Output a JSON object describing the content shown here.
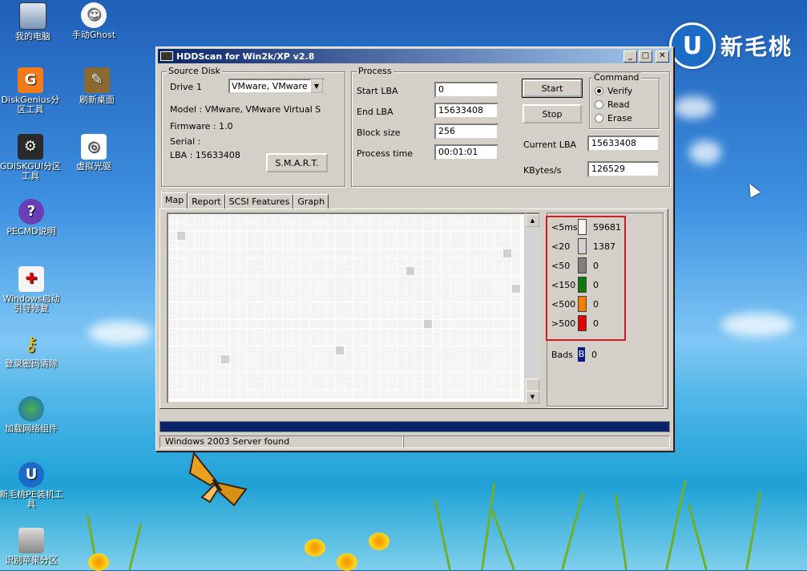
{
  "desktop": {
    "brand_text": "新毛桃",
    "icons": [
      {
        "label": "我的电脑"
      },
      {
        "label": "手动Ghost"
      },
      {
        "label": "DiskGenius分区工具"
      },
      {
        "label": "刷新桌面"
      },
      {
        "label": "GDISKGUI分区工具"
      },
      {
        "label": "虚拟光驱"
      },
      {
        "label": "PECMD说明"
      },
      {
        "label": "Windows启动引导修复"
      },
      {
        "label": "登录密码清除"
      },
      {
        "label": "加载网络组件"
      },
      {
        "label": "新毛桃PE装机工具"
      },
      {
        "label": "识别苹果分区"
      }
    ]
  },
  "window": {
    "title": "HDDScan for Win2k/XP  v2.8",
    "buttons": {
      "minimize": "_",
      "maximize": "□",
      "close": "✕"
    },
    "source_disk": {
      "legend": "Source Disk",
      "drive_label": "Drive",
      "drive_number": "1",
      "drive_select": "VMware, VMware Vir",
      "model": "Model : VMware, VMware Virtual S",
      "firmware": "Firmware : 1.0",
      "serial": "Serial :",
      "lba": "LBA :  15633408",
      "smart_button": "S.M.A.R.T."
    },
    "process": {
      "legend": "Process",
      "start_lba_label": "Start LBA",
      "start_lba": "0",
      "end_lba_label": "End LBA",
      "end_lba": "15633408",
      "block_size_label": "Block size",
      "block_size": "256",
      "process_time_label": "Process time",
      "process_time": "00:01:01",
      "start_button": "Start",
      "stop_button": "Stop",
      "current_lba_label": "Current LBA",
      "current_lba": "15633408",
      "kbytes_label": "KBytes/s",
      "kbytes": "126529"
    },
    "command": {
      "legend": "Command",
      "options": [
        {
          "label": "Verify",
          "checked": true
        },
        {
          "label": "Read",
          "checked": false
        },
        {
          "label": "Erase",
          "checked": false
        }
      ]
    },
    "tabs": [
      {
        "label": "Map",
        "active": true
      },
      {
        "label": "Report",
        "active": false
      },
      {
        "label": "SCSI Features",
        "active": false
      },
      {
        "label": "Graph",
        "active": false
      }
    ],
    "legend_rows": [
      {
        "label": "<5ms",
        "count": "59681",
        "color": "#f4f4f4"
      },
      {
        "label": "<20",
        "count": "1387",
        "color": "#d0d0d0"
      },
      {
        "label": "<50",
        "count": "0",
        "color": "#808080"
      },
      {
        "label": "<150",
        "count": "0",
        "color": "#0a7a0a"
      },
      {
        "label": "<500",
        "count": "0",
        "color": "#f08000"
      },
      {
        "label": ">500",
        "count": "0",
        "color": "#e00000"
      }
    ],
    "bads": {
      "label": "Bads",
      "marker": "B",
      "count": "0",
      "color": "#0a1a8a"
    },
    "progress": 1.0,
    "status": "Windows 2003 Server found"
  }
}
